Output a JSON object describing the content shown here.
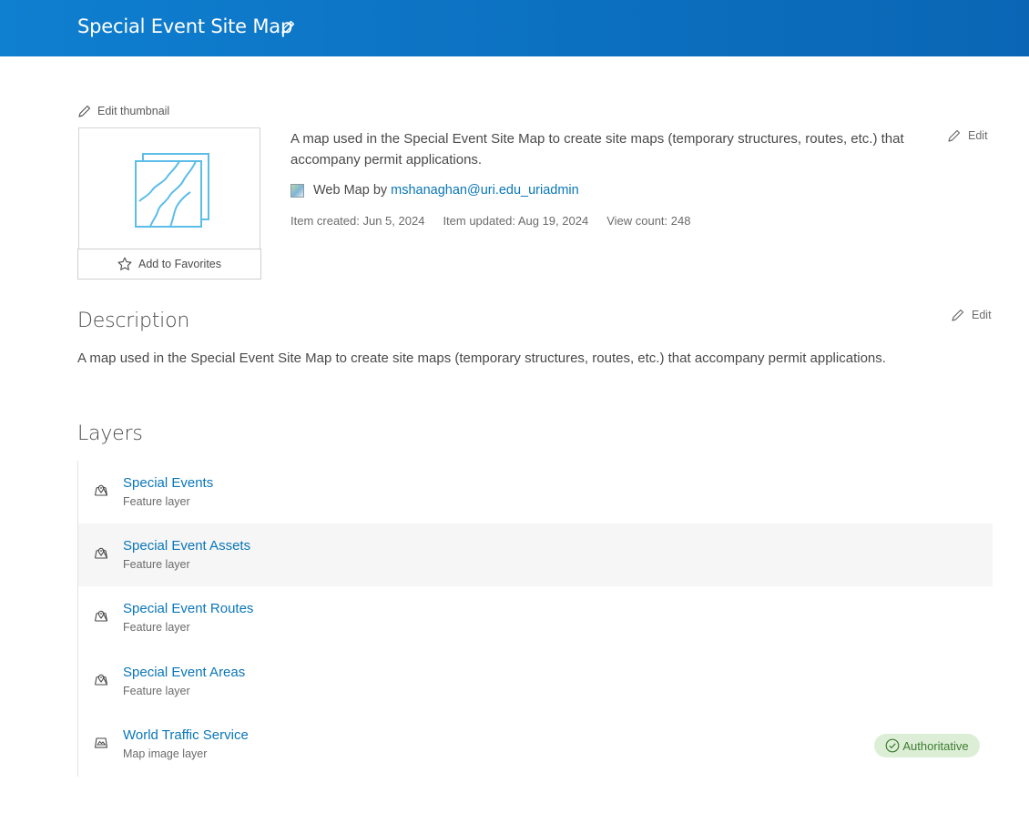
{
  "header": {
    "title": "Special Event Site Map"
  },
  "thumbnail": {
    "edit_label": "Edit thumbnail",
    "favorites_label": "Add to Favorites"
  },
  "summary": {
    "text": "A map used in the Special Event Site Map to create site maps (temporary structures, routes, etc.) that accompany permit applications.",
    "edit_label": "Edit",
    "item_type": "Web Map by",
    "owner": "mshanaghan@uri.edu_uriadmin",
    "created": "Item created: Jun 5, 2024",
    "updated": "Item updated: Aug 19, 2024",
    "views": "View count: 248"
  },
  "description": {
    "title": "Description",
    "edit_label": "Edit",
    "text": "A map used in the Special Event Site Map to create site maps (temporary structures, routes, etc.) that accompany permit applications."
  },
  "layers": {
    "title": "Layers",
    "items": [
      {
        "name": "Special Events",
        "type": "Feature layer",
        "icon": "feature-layer-icon"
      },
      {
        "name": "Special Event Assets",
        "type": "Feature layer",
        "icon": "feature-layer-icon"
      },
      {
        "name": "Special Event Routes",
        "type": "Feature layer",
        "icon": "feature-layer-icon"
      },
      {
        "name": "Special Event Areas",
        "type": "Feature layer",
        "icon": "feature-layer-icon"
      },
      {
        "name": "World Traffic Service",
        "type": "Map image layer",
        "icon": "map-image-layer-icon",
        "badge": "Authoritative"
      }
    ]
  },
  "colors": {
    "header": "#0c6fbf",
    "link": "#0a76b8",
    "badge_bg": "#dcefd6",
    "badge_text": "#3f7a32"
  }
}
